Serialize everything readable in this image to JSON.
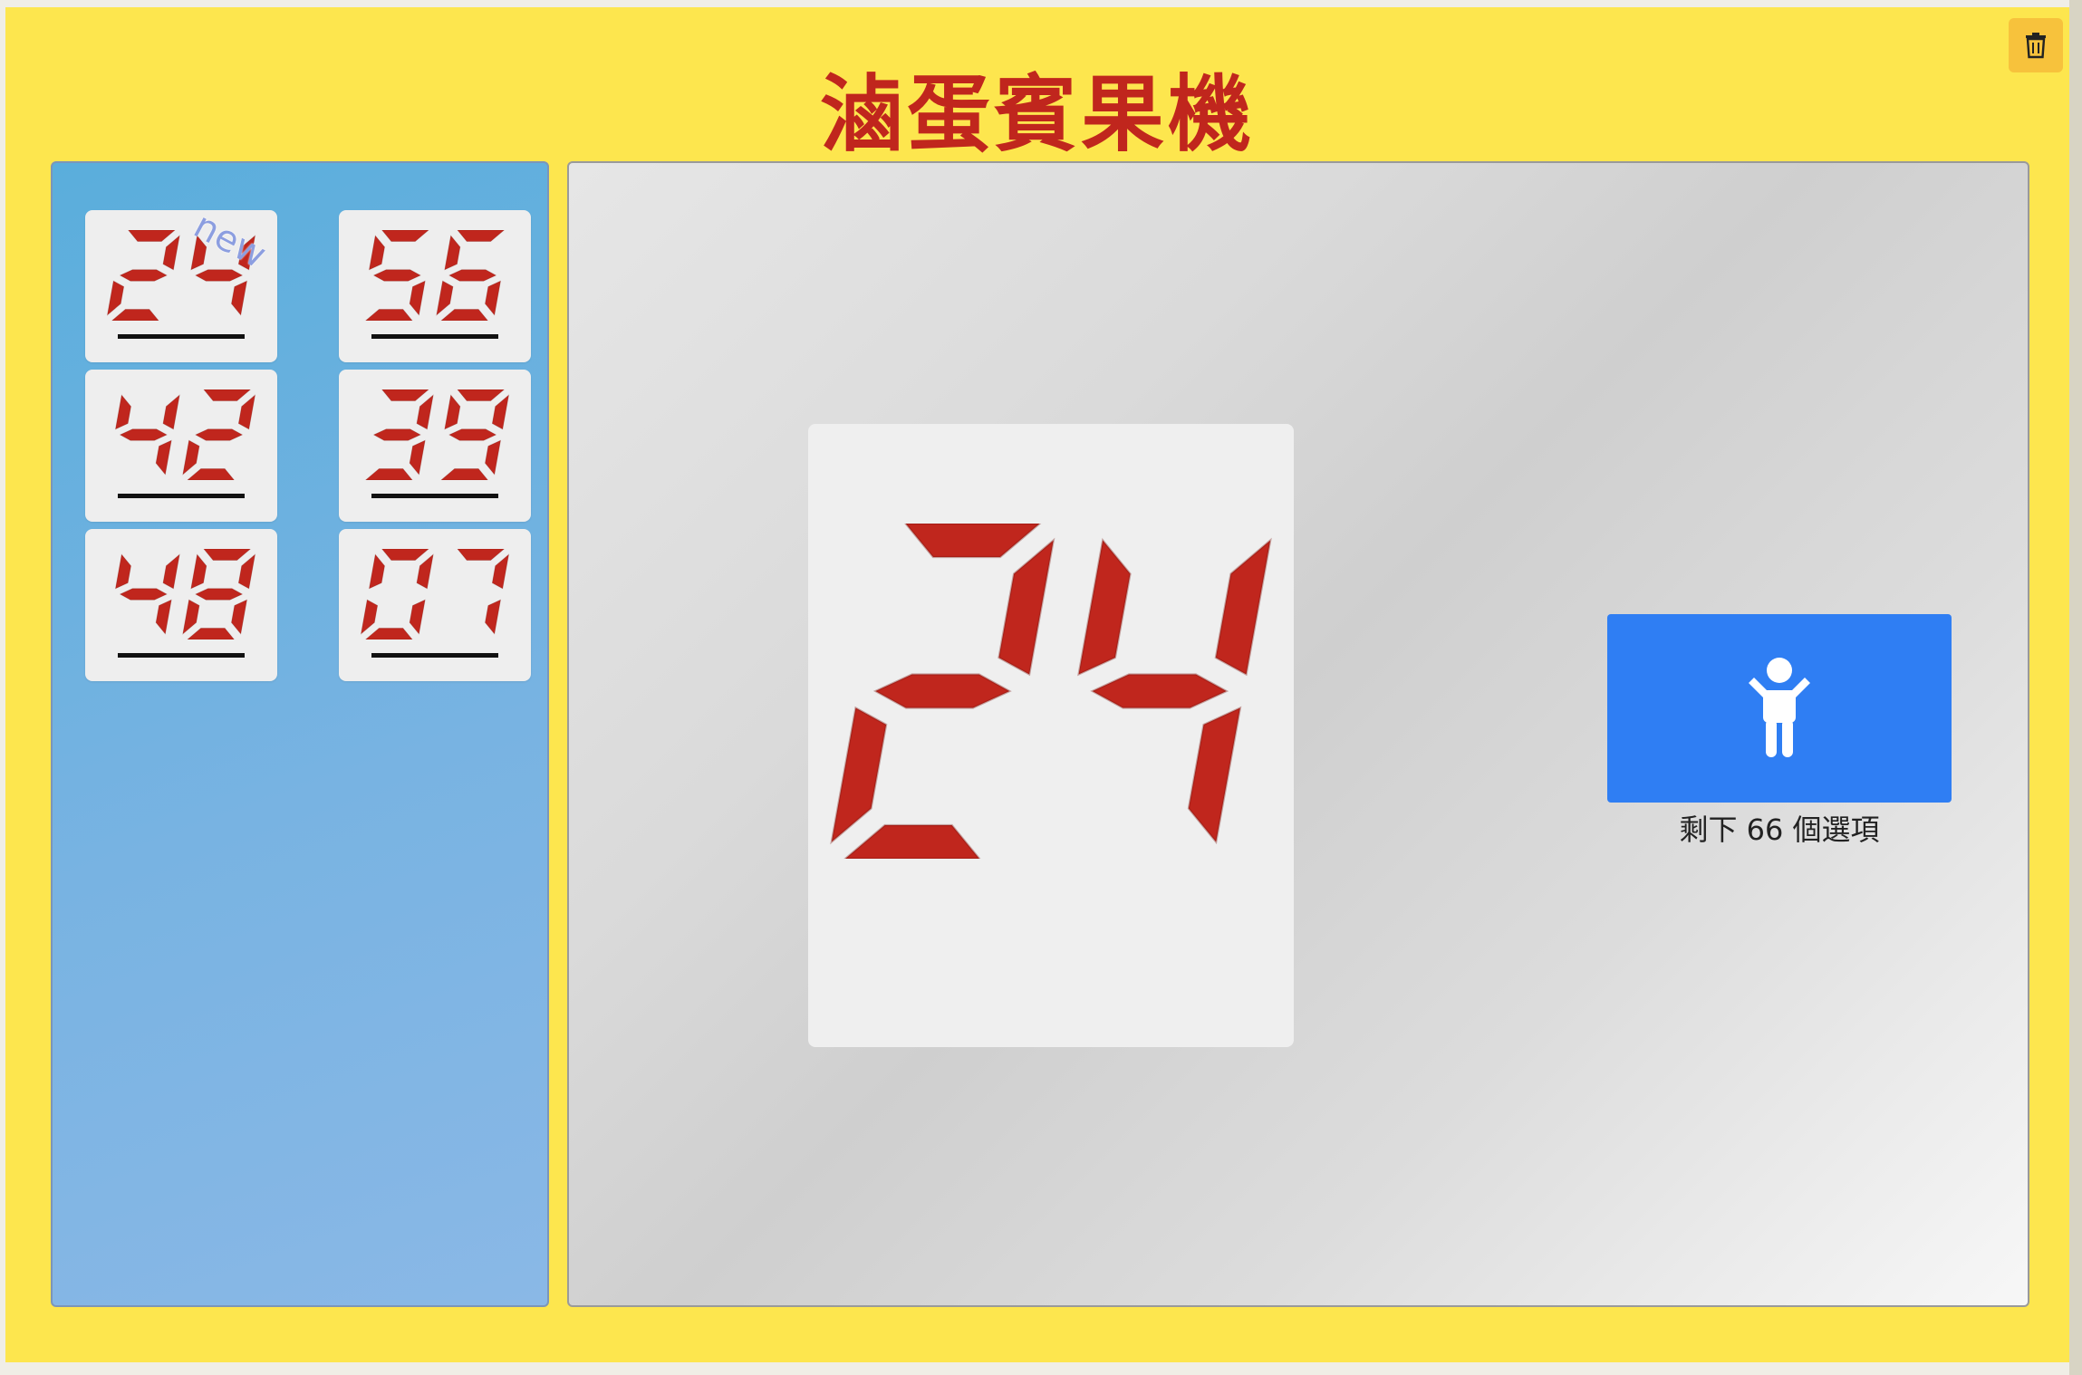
{
  "app": {
    "title": "滷蛋賓果機"
  },
  "toolbar": {
    "trash_icon": "trash-icon"
  },
  "history": {
    "items": [
      {
        "number": "24",
        "new_label": "new"
      },
      {
        "number": "56"
      },
      {
        "number": "42"
      },
      {
        "number": "39"
      },
      {
        "number": "48"
      },
      {
        "number": "07"
      }
    ]
  },
  "display": {
    "current": "24"
  },
  "draw": {
    "icon": "child-icon",
    "remaining_text": "剩下 66 個選項"
  },
  "colors": {
    "background": "#fde64e",
    "title": "#c0261d",
    "digit": "#c0261d",
    "panel": "#5aaedc",
    "button": "#2f7ef3",
    "trash_button": "#f7c23c"
  }
}
